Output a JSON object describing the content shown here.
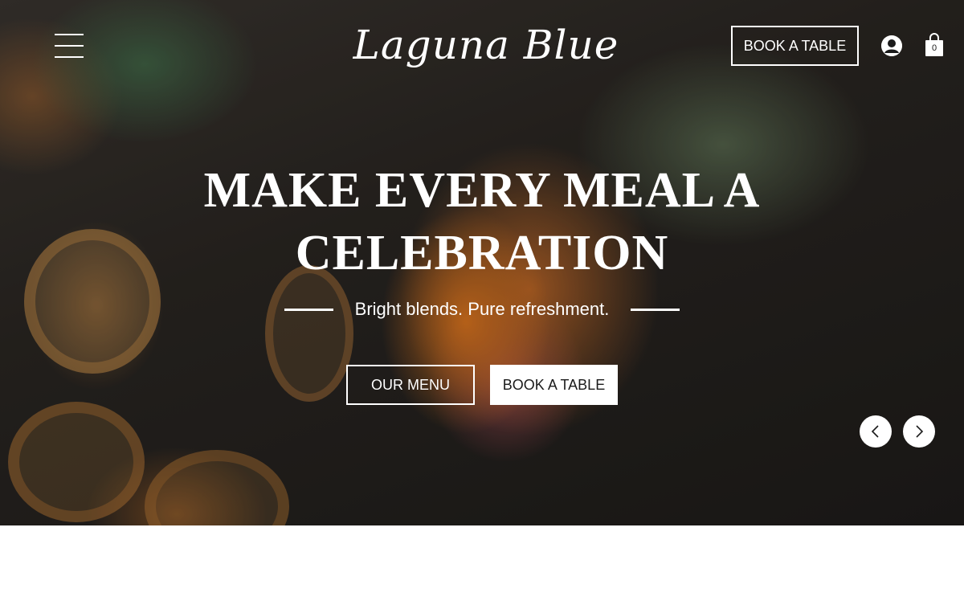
{
  "header": {
    "menu_icon": "hamburger-menu-icon",
    "logo_text": "Laguna Blue",
    "book_label": "BOOK A TABLE",
    "account_icon": "user-account-icon",
    "cart_icon": "shopping-bag-icon",
    "cart_count": "0"
  },
  "hero": {
    "headline": "MAKE EVERY MEAL A CELEBRATION",
    "subheadline": "Bright blends. Pure refreshment.",
    "primary_button": "OUR MENU",
    "secondary_button": "BOOK A TABLE",
    "prev_icon": "chevron-left-icon",
    "next_icon": "chevron-right-icon"
  },
  "colors": {
    "text_light": "#ffffff",
    "button_bg": "#ffffff",
    "button_text": "#1a1a1a"
  }
}
